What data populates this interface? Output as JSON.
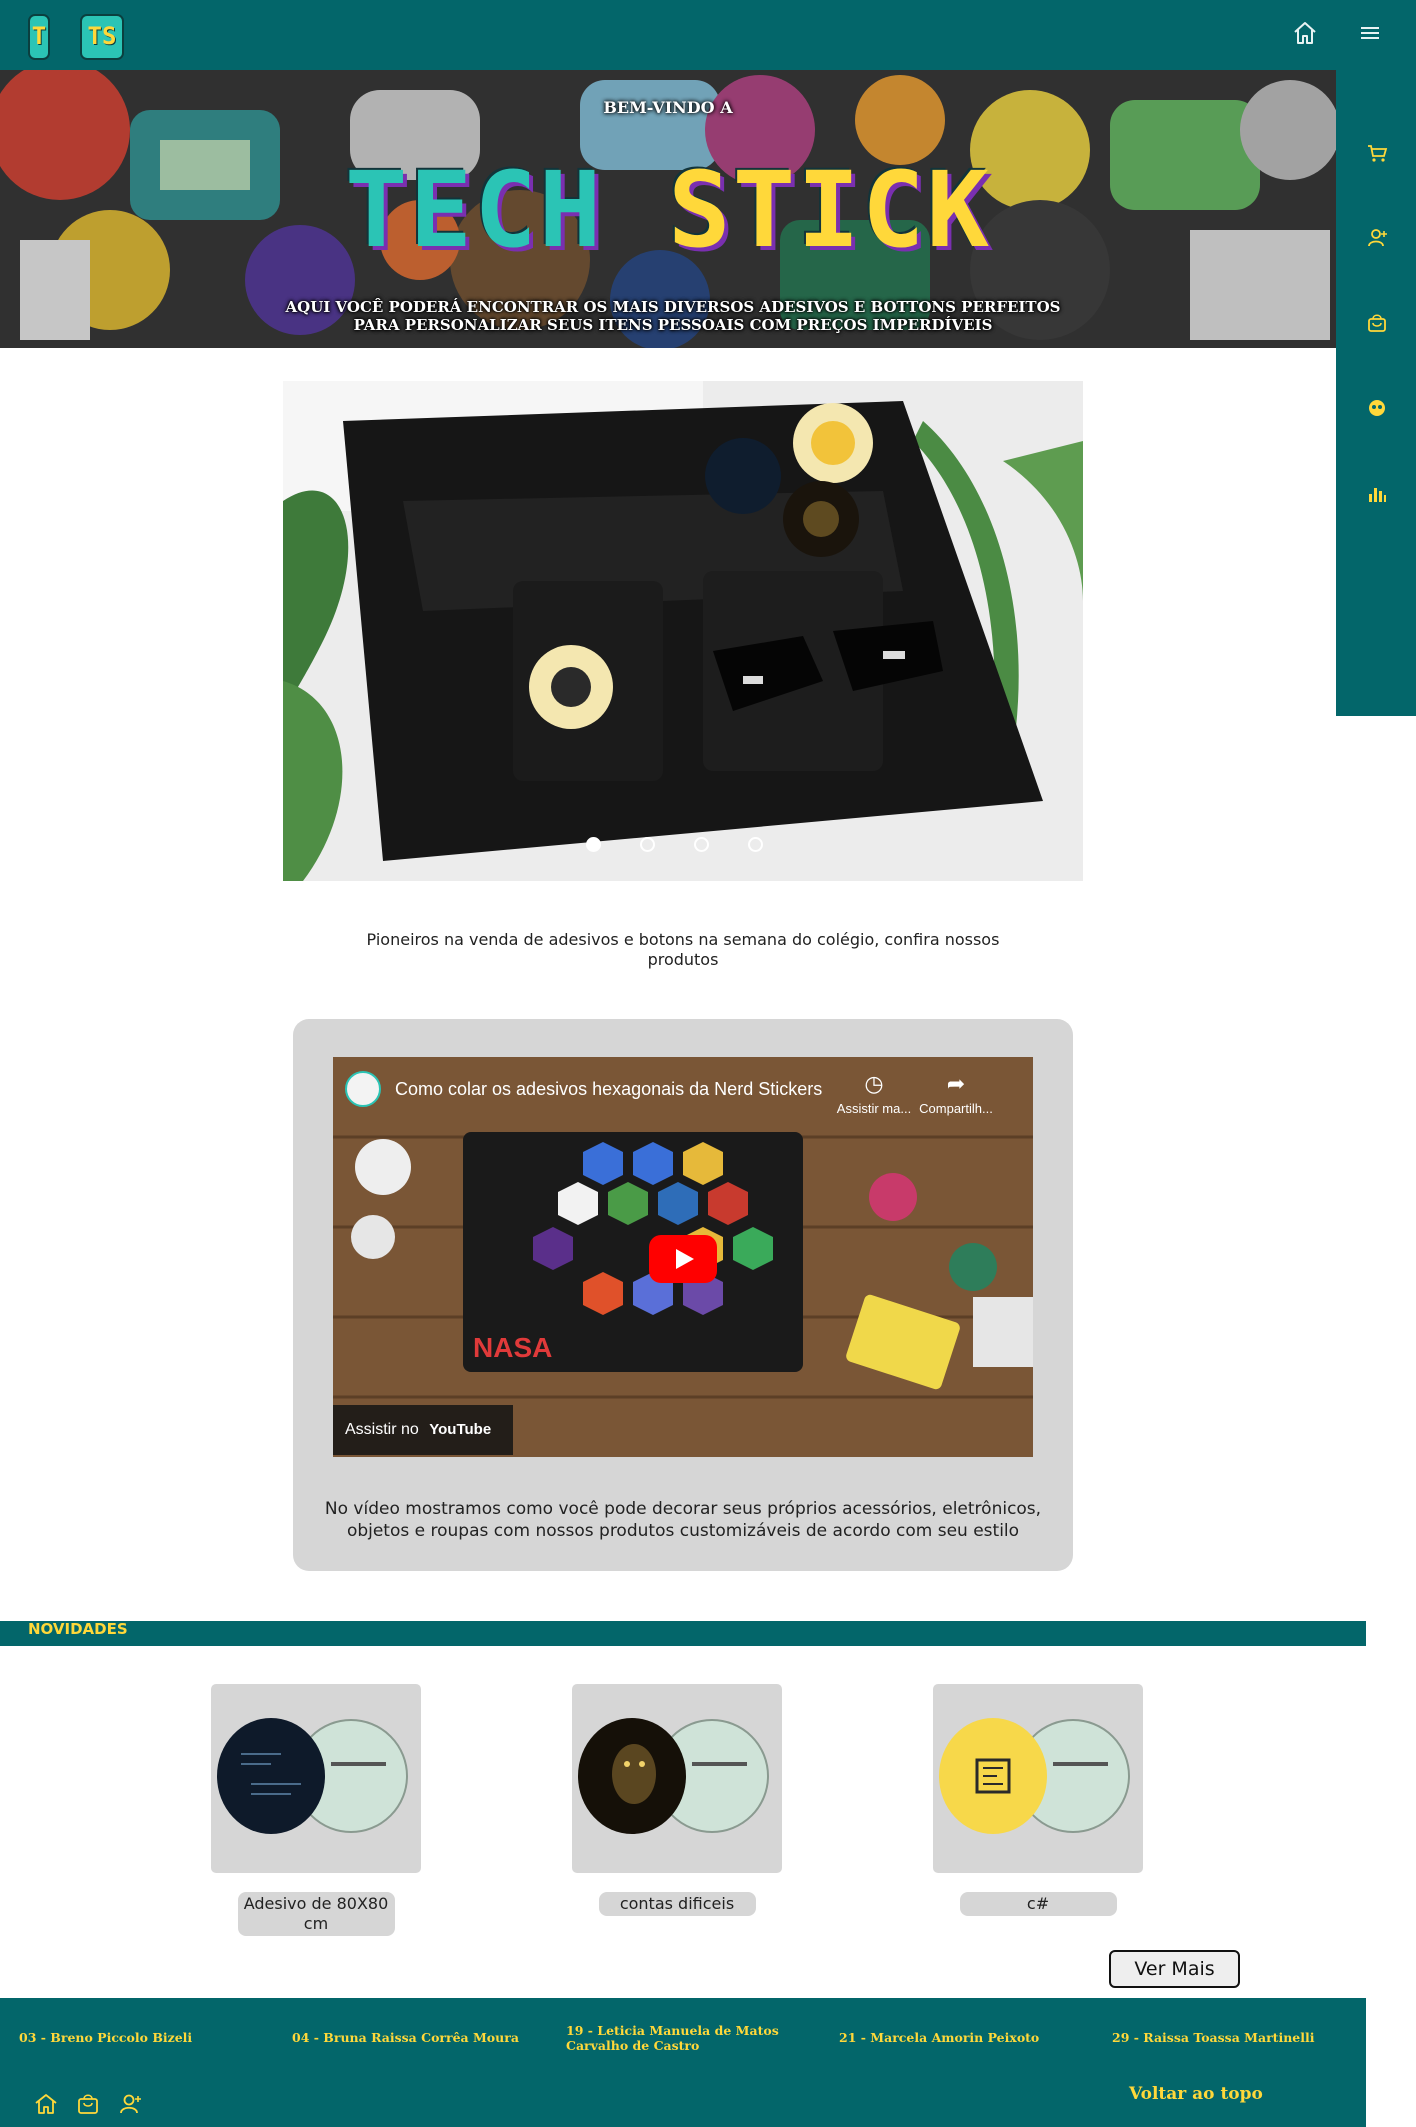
{
  "header": {
    "logo_letters": [
      "T",
      "TS"
    ],
    "icons": [
      "home-icon",
      "menu-icon"
    ]
  },
  "side_rail": {
    "icons": [
      "cart-icon",
      "user-icon",
      "shopping-bag-icon",
      "emoji-icon",
      "chart-icon"
    ]
  },
  "hero": {
    "kicker": "BEM-VINDO A",
    "title_part1": "TECH",
    "title_part2": "STICK",
    "subtitle": "AQUI VOCÊ PODERÁ ENCONTRAR OS MAIS DIVERSOS ADESIVOS E BOTTONS PERFEITOS PARA PERSONALIZAR SEUS ITENS PESSOAIS COM PREÇOS IMPERDÍVEIS"
  },
  "carousel": {
    "slide_count": 4,
    "active_index": 0
  },
  "intro": {
    "text": "Pioneiros na venda de adesivos e botons na semana do colégio, confira nossos produtos"
  },
  "video": {
    "title": "Como colar os adesivos hexagonais da Nerd Stickers",
    "watch_later": "Assistir ma...",
    "share": "Compartilh...",
    "watch_on": "Assistir no",
    "platform": "YouTube",
    "caption": "No vídeo mostramos como você pode decorar seus próprios acessórios, eletrônicos, objetos e roupas com nossos produtos customizáveis de acordo com seu estilo"
  },
  "novidades": {
    "label": "NOVIDADES",
    "products": [
      {
        "name": "Adesivo de 80X80 cm"
      },
      {
        "name": "contas dificeis"
      },
      {
        "name": "c#"
      }
    ],
    "more_button": "Ver Mais"
  },
  "footer": {
    "credits": [
      "03 - Breno Piccolo Bizeli",
      "04 - Bruna Raissa Corrêa Moura",
      "19 - Leticia Manuela de Matos Carvalho de Castro",
      "21 - Marcela Amorin Peixoto",
      "29 - Raissa Toassa Martinelli"
    ],
    "back_to_top": "Voltar ao topo",
    "icons": [
      "home-icon",
      "shopping-bag-icon",
      "user-icon"
    ]
  },
  "colors": {
    "brand_teal": "#03666a",
    "accent_yellow": "#ffd83a",
    "title_teal": "#2bc4b5",
    "card_gray": "#d6d6d6"
  }
}
